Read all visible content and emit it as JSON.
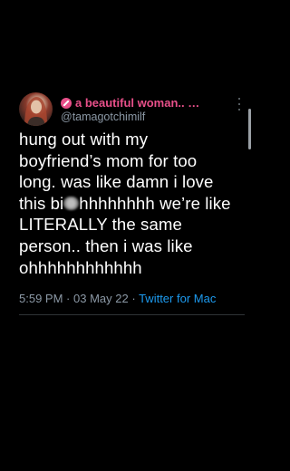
{
  "author": {
    "display_name": "a beautiful woman.. …",
    "handle": "@tamagotchimilf",
    "name_color": "#e8508a"
  },
  "tweet": {
    "line1": "hung out with my",
    "line2": "boyfriend’s mom for too",
    "line3": "long. was like damn i love",
    "line4_prefix": "this bi",
    "line4_suffix": "hhhhhhhh we’re like",
    "line5": "LITERALLY the same",
    "line6": "person.. then i was like",
    "line7": "ohhhhhhhhhhhh"
  },
  "meta": {
    "time": "5:59 PM",
    "separator": "·",
    "date": "03 May 22",
    "source": "Twitter for Mac"
  },
  "icons": {
    "badge": "broken-heart-emoji-icon",
    "more": "more-options-icon",
    "blur": "censor-blur-icon"
  },
  "colors": {
    "background": "#000000",
    "text": "#ffffff",
    "secondary": "#8b98a5",
    "link": "#1d9bf0"
  }
}
